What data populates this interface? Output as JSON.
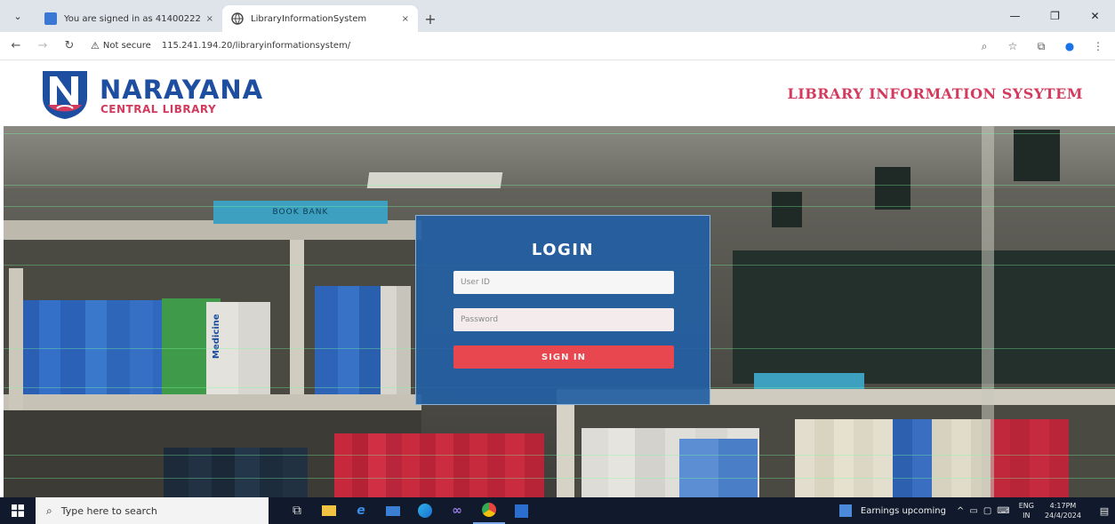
{
  "browser": {
    "tabs": [
      {
        "title": "You are signed in as 41400222",
        "close": "×"
      },
      {
        "title": "LibraryInformationSystem",
        "close": "×"
      }
    ],
    "new_tab": "+",
    "menu": "⌄",
    "window": {
      "minimize": "—",
      "restore": "❐",
      "close": "✕"
    },
    "address": {
      "warning": "⚠",
      "security": "Not secure",
      "url": "115.241.194.20/libraryinformationsystem/"
    },
    "nav": {
      "back": "←",
      "forward": "→",
      "reload": "↻"
    },
    "toolbar": {
      "zoom": "⌕",
      "bookmark": "☆",
      "extensions": "⧉",
      "profile": "●",
      "more": "⋮"
    }
  },
  "site": {
    "brand": "NARAYANA",
    "brand_sub": "CENTRAL LIBRARY",
    "title": "LIBRARY INFORMATION SYSYTEM",
    "colors": {
      "brand_blue": "#1d4ea0",
      "accent_pink": "#d23b5e",
      "card_blue": "#2460a4",
      "button_red": "#e8474f"
    }
  },
  "hero": {
    "sign_left": "BOOK BANK",
    "book_label": "Medicine"
  },
  "login": {
    "title": "LOGIN",
    "user_placeholder": "User ID",
    "password_placeholder": "Password",
    "submit_label": "SIGN IN"
  },
  "taskbar": {
    "search_placeholder": "Type here to search",
    "search_icon": "⌕",
    "apps": [
      "task-view-icon",
      "file-explorer-icon",
      "ie-icon",
      "mail-icon",
      "edge-icon",
      "app-icon",
      "chrome-icon",
      "outlook-icon"
    ],
    "news": "Earnings upcoming",
    "lang_top": "ENG",
    "lang_bottom": "IN",
    "time": "4:17PM",
    "date": "24/4/2024"
  }
}
